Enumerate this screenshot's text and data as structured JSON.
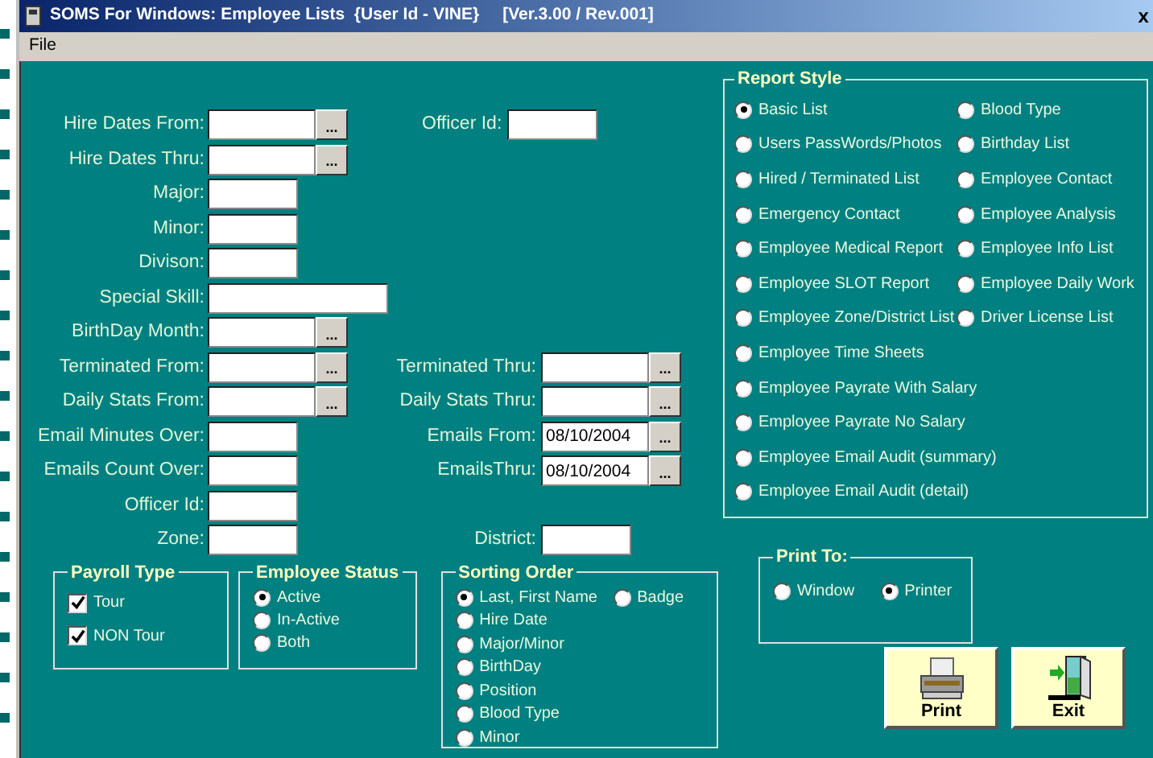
{
  "window": {
    "title": "SOMS For Windows: Employee Lists  {User Id - VINE}     [Ver.3.00 / Rev.001]",
    "close": "x"
  },
  "menu": [
    "File"
  ],
  "form_rows": [
    {
      "left": {
        "label": "Hire Dates From:",
        "kind": "date",
        "button": "..."
      },
      "right": {
        "label": "Officer Id:",
        "kind": "text"
      }
    },
    {
      "left": {
        "label": "Hire Dates Thru:",
        "kind": "date",
        "button": "..."
      }
    },
    {
      "left": {
        "label": "Major:",
        "kind": "text"
      }
    },
    {
      "left": {
        "label": "Minor:",
        "kind": "text"
      }
    },
    {
      "left": {
        "label": "Divison:",
        "kind": "text"
      }
    },
    {
      "left": {
        "label": "Special Skill:",
        "kind": "long"
      }
    },
    {
      "left": {
        "label": "BirthDay Month:",
        "kind": "date",
        "button": "..."
      }
    },
    {
      "left": {
        "label": "Terminated From:",
        "kind": "date",
        "button": "..."
      },
      "right": {
        "label": "Terminated Thru:",
        "kind": "date",
        "button": "..."
      }
    },
    {
      "left": {
        "label": "Daily Stats From:",
        "kind": "date",
        "button": "..."
      },
      "right": {
        "label": "Daily Stats Thru:",
        "kind": "date",
        "button": "..."
      }
    },
    {
      "left": {
        "label": "Email Minutes Over:",
        "kind": "text"
      },
      "right": {
        "label": "Emails From:",
        "kind": "date",
        "value": "08/10/2004",
        "button": "..."
      }
    },
    {
      "left": {
        "label": "Emails Count Over:",
        "kind": "text"
      },
      "right": {
        "label": "EmailsThru:",
        "kind": "date",
        "value": "08/10/2004",
        "button": "..."
      }
    },
    {
      "left": {
        "label": "Officer Id:",
        "kind": "text"
      }
    },
    {
      "left": {
        "label": "Zone:",
        "kind": "text"
      },
      "right": {
        "label": "District:",
        "kind": "text"
      }
    }
  ],
  "payroll_type": {
    "title": "Payroll Type",
    "options": [
      {
        "label": "Tour",
        "checked": true
      },
      {
        "label": "NON Tour",
        "checked": true
      }
    ]
  },
  "employee_status": {
    "title": "Employee Status",
    "options": [
      {
        "label": "Active",
        "selected": true
      },
      {
        "label": "In-Active",
        "selected": false
      },
      {
        "label": "Both",
        "selected": false
      }
    ]
  },
  "sorting_order": {
    "title": "Sorting Order",
    "options": [
      {
        "label": "Last, First Name",
        "selected": true
      },
      {
        "label": "Badge",
        "selected": false
      },
      {
        "label": "Hire Date",
        "selected": false
      },
      {
        "label": "Major/Minor",
        "selected": false
      },
      {
        "label": "BirthDay",
        "selected": false
      },
      {
        "label": "Position",
        "selected": false
      },
      {
        "label": "Blood Type",
        "selected": false
      },
      {
        "label": "Minor",
        "selected": false
      }
    ]
  },
  "report_style": {
    "title": "Report Style",
    "options": [
      {
        "label": "Basic List",
        "selected": true
      },
      {
        "label": "Blood Type",
        "selected": false
      },
      {
        "label": "Users PassWords/Photos",
        "selected": false
      },
      {
        "label": "Birthday List",
        "selected": false
      },
      {
        "label": "Hired / Terminated List",
        "selected": false
      },
      {
        "label": "Employee Contact",
        "selected": false
      },
      {
        "label": "Emergency Contact",
        "selected": false
      },
      {
        "label": "Employee Analysis",
        "selected": false
      },
      {
        "label": "Employee Medical Report",
        "selected": false
      },
      {
        "label": "Employee Info List",
        "selected": false
      },
      {
        "label": "Employee SLOT Report",
        "selected": false
      },
      {
        "label": "Employee Daily Work",
        "selected": false
      },
      {
        "label": "Employee Zone/District List",
        "selected": false
      },
      {
        "label": "Driver License List",
        "selected": false
      },
      {
        "label": "Employee Time Sheets",
        "selected": false
      },
      {
        "label": "Employee Payrate With Salary",
        "selected": false
      },
      {
        "label": "Employee Payrate No Salary",
        "selected": false
      },
      {
        "label": "Employee Email Audit (summary)",
        "selected": false
      },
      {
        "label": "Employee Email Audit (detail)",
        "selected": false
      }
    ]
  },
  "print_to": {
    "title": "Print To:",
    "options": [
      {
        "label": "Window",
        "selected": false
      },
      {
        "label": "Printer",
        "selected": true
      }
    ]
  },
  "buttons": [
    {
      "label": "Print",
      "kind": "print"
    },
    {
      "label": "Exit",
      "kind": "exit"
    }
  ]
}
